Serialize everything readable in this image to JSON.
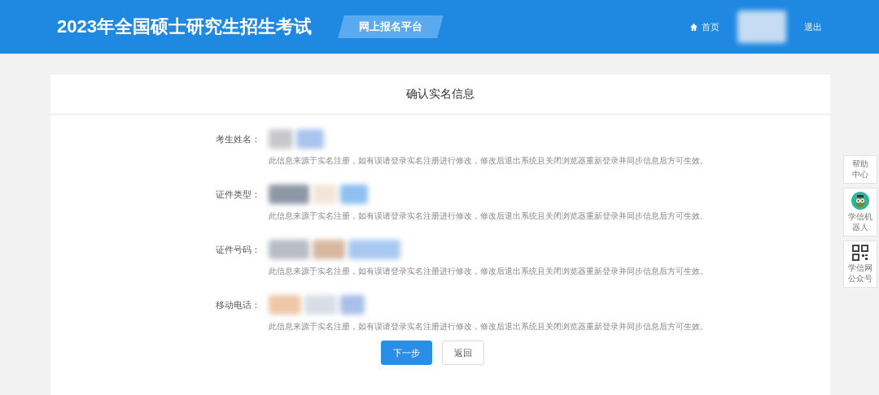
{
  "header": {
    "title": "2023年全国硕士研究生招生考试",
    "badge": "网上报名平台",
    "nav": [
      {
        "kind": "home",
        "label": "首页"
      },
      {
        "kind": "user"
      },
      {
        "kind": "link",
        "label": "退出"
      }
    ]
  },
  "card": {
    "title": "确认实名信息",
    "fields": [
      {
        "label": "考生姓名：",
        "note": "此信息来源于实名注册，如有误请登录实名注册进行修改，修改后退出系统且关闭浏览器重新登录并同步信息后方可生效。"
      },
      {
        "label": "证件类型：",
        "note": "此信息来源于实名注册，如有误请登录实名注册进行修改，修改后退出系统且关闭浏览器重新登录并同步信息后方可生效。"
      },
      {
        "label": "证件号码：",
        "note": "此信息来源于实名注册，如有误请登录实名注册进行修改，修改后退出系统且关闭浏览器重新登录并同步信息后方可生效。"
      },
      {
        "label": "移动电话：",
        "note": "此信息来源于实名注册，如有误请登录实名注册进行修改，修改后退出系统且关闭浏览器重新登录并同步信息后方可生效。"
      }
    ],
    "buttons": [
      {
        "kind": "primary",
        "label": "下一步"
      },
      {
        "kind": "default",
        "label": "返回"
      }
    ]
  },
  "side_tools": [
    {
      "kind": "text",
      "label": "帮助中心"
    },
    {
      "kind": "robot",
      "label": "学信机器人"
    },
    {
      "kind": "qr",
      "label": "学信网公众号"
    }
  ]
}
